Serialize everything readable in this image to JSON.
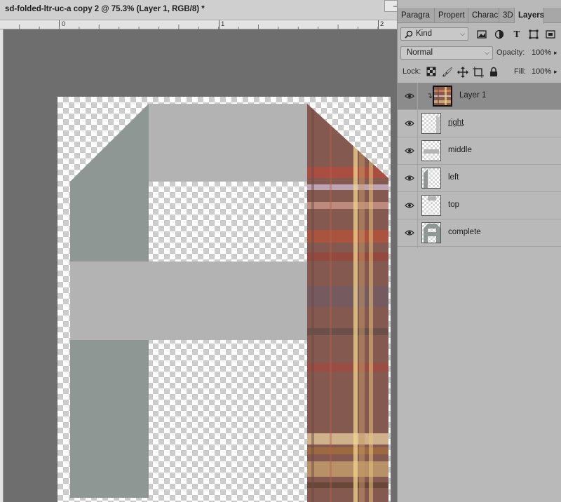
{
  "document": {
    "title": "sd-folded-ltr-uc-a copy 2 @ 75.3% (Layer 1, RGB/8) *",
    "window_buttons": [
      "—",
      "✕"
    ],
    "ruler_labels": [
      "0",
      "1",
      "2"
    ]
  },
  "panel": {
    "tabs": [
      {
        "label": "Paragra",
        "active": false
      },
      {
        "label": "Propert",
        "active": false
      },
      {
        "label": "Charact",
        "active": false
      },
      {
        "label": "3D",
        "active": false
      },
      {
        "label": "Layers",
        "active": true
      }
    ],
    "filter": {
      "kind_label": "Kind",
      "icons": [
        "search-icon",
        "image-filter-icon",
        "adjustment-filter-icon",
        "type-filter-icon",
        "shape-filter-icon",
        "smart-object-filter-icon"
      ]
    },
    "blend_mode": "Normal",
    "opacity": {
      "label": "Opacity:",
      "value": "100%"
    },
    "lock": {
      "label": "Lock:",
      "icons": [
        "lock-transparent-icon",
        "lock-image-icon",
        "lock-position-icon",
        "lock-artboard-icon",
        "lock-all-icon"
      ]
    },
    "fill": {
      "label": "Fill:",
      "value": "100%"
    },
    "layers": [
      {
        "name": "Layer 1",
        "selected": true,
        "visible": true,
        "clipped": true,
        "thumb": "plaid"
      },
      {
        "name": "right",
        "selected": false,
        "visible": true,
        "clipped": false,
        "thumb": "right"
      },
      {
        "name": "middle",
        "selected": false,
        "visible": true,
        "clipped": false,
        "thumb": "middle"
      },
      {
        "name": "left",
        "selected": false,
        "visible": true,
        "clipped": false,
        "thumb": "left"
      },
      {
        "name": "top",
        "selected": false,
        "visible": true,
        "clipped": false,
        "thumb": "top"
      },
      {
        "name": "complete",
        "selected": false,
        "visible": true,
        "clipped": false,
        "thumb": "complete"
      }
    ]
  },
  "colors": {
    "left_piece": "#8e9794",
    "gray_piece": "#b3b3b3",
    "plaid_base": "#8a5a4e",
    "selected_row": "#8c8c8c"
  }
}
